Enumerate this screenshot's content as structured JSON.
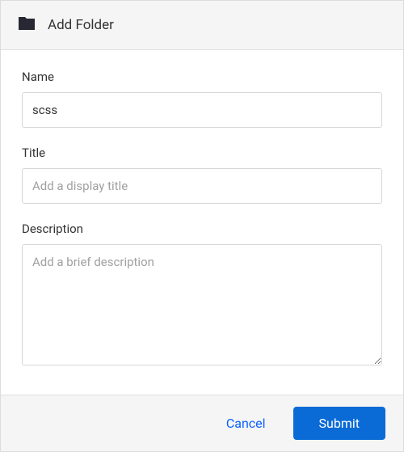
{
  "header": {
    "title": "Add Folder"
  },
  "form": {
    "name": {
      "label": "Name",
      "value": "scss",
      "placeholder": ""
    },
    "title_field": {
      "label": "Title",
      "value": "",
      "placeholder": "Add a display title"
    },
    "description": {
      "label": "Description",
      "value": "",
      "placeholder": "Add a brief description"
    }
  },
  "footer": {
    "cancel_label": "Cancel",
    "submit_label": "Submit"
  }
}
